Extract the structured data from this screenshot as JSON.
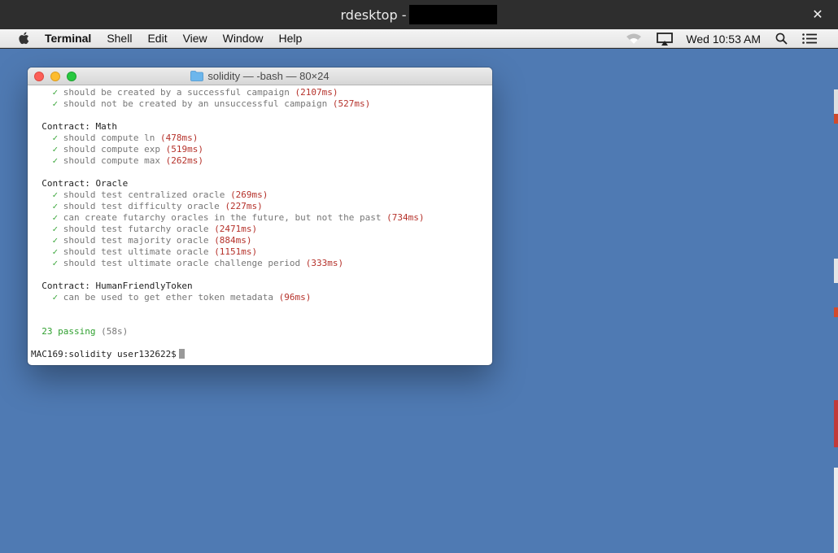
{
  "outer_window": {
    "title": "rdesktop -",
    "close_glyph": "✕"
  },
  "menubar": {
    "app_name": "Terminal",
    "items": [
      "Shell",
      "Edit",
      "View",
      "Window",
      "Help"
    ],
    "clock": "Wed 10:53 AM",
    "icons": [
      "apple-icon",
      "wifi-icon",
      "airplay-icon",
      "search-icon",
      "notification-list-icon"
    ]
  },
  "terminal": {
    "title": "solidity — -bash — 80×24",
    "lines": [
      {
        "kind": "test",
        "text": "should be created by a successful campaign",
        "ms": "(2107ms)"
      },
      {
        "kind": "test",
        "text": "should not be created by an unsuccessful campaign",
        "ms": "(527ms)"
      },
      {
        "kind": "blank"
      },
      {
        "kind": "header",
        "text": "Contract: Math"
      },
      {
        "kind": "test",
        "text": "should compute ln",
        "ms": "(478ms)"
      },
      {
        "kind": "test",
        "text": "should compute exp",
        "ms": "(519ms)"
      },
      {
        "kind": "test",
        "text": "should compute max",
        "ms": "(262ms)"
      },
      {
        "kind": "blank"
      },
      {
        "kind": "header",
        "text": "Contract: Oracle"
      },
      {
        "kind": "test",
        "text": "should test centralized oracle",
        "ms": "(269ms)"
      },
      {
        "kind": "test",
        "text": "should test difficulty oracle",
        "ms": "(227ms)"
      },
      {
        "kind": "test",
        "text": "can create futarchy oracles in the future, but not the past",
        "ms": "(734ms)"
      },
      {
        "kind": "test",
        "text": "should test futarchy oracle",
        "ms": "(2471ms)"
      },
      {
        "kind": "test",
        "text": "should test majority oracle",
        "ms": "(884ms)"
      },
      {
        "kind": "test",
        "text": "should test ultimate oracle",
        "ms": "(1151ms)"
      },
      {
        "kind": "test",
        "text": "should test ultimate oracle challenge period",
        "ms": "(333ms)"
      },
      {
        "kind": "blank"
      },
      {
        "kind": "header",
        "text": "Contract: HumanFriendlyToken"
      },
      {
        "kind": "test",
        "text": "can be used to get ether token metadata",
        "ms": "(96ms)"
      },
      {
        "kind": "blank"
      },
      {
        "kind": "blank"
      },
      {
        "kind": "summary",
        "text": "23 passing",
        "ms": "(58s)"
      },
      {
        "kind": "blank"
      },
      {
        "kind": "prompt",
        "text": "MAC169:solidity user132622$"
      }
    ],
    "check_glyph": "✓"
  },
  "colors": {
    "desktop": "#4f7ab3",
    "duration": "#b5312a",
    "check": "#3aa63a",
    "passing": "#2fa02f"
  }
}
